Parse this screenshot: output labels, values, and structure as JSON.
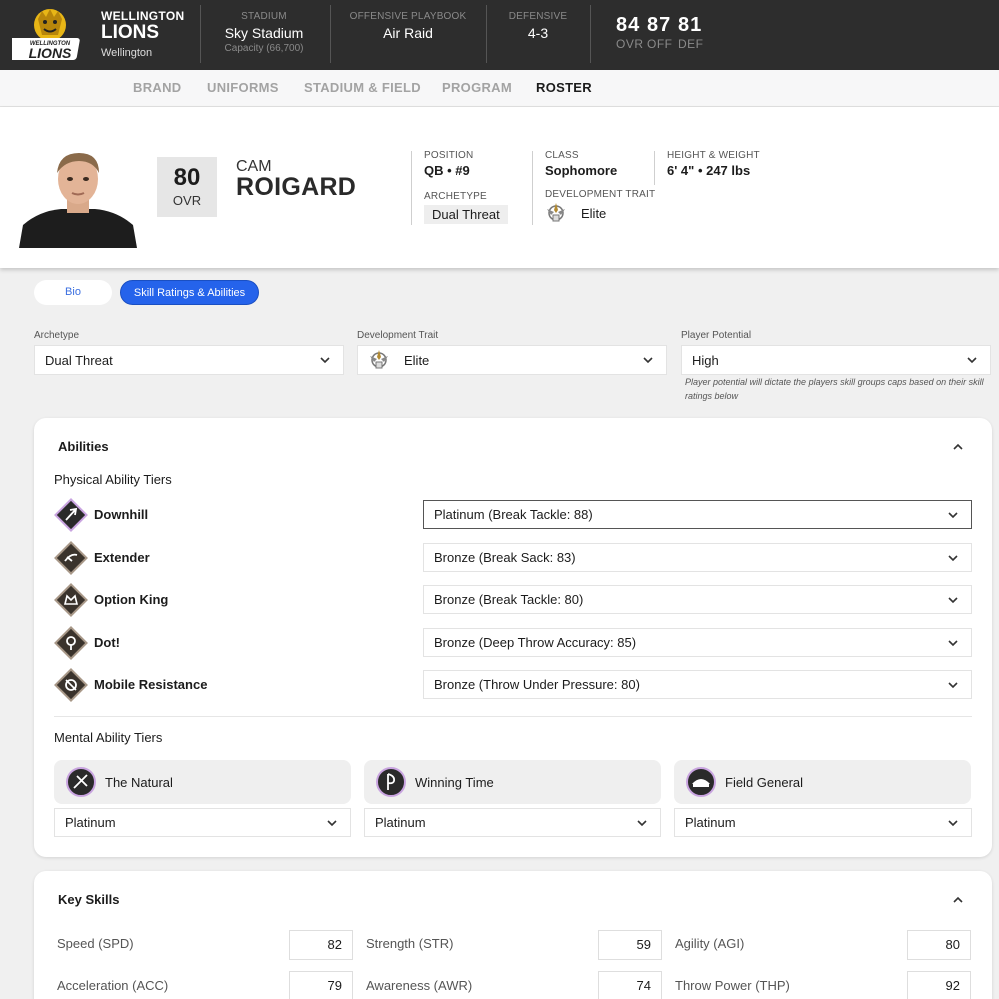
{
  "team": {
    "city": "WELLINGTON",
    "name": "LIONS",
    "location": "Wellington",
    "logo_text": "WELLINGTON LIONS"
  },
  "header": {
    "stadium": {
      "label": "STADIUM",
      "value": "Sky Stadium",
      "sub": "Capacity (66,700)"
    },
    "offense": {
      "label": "OFFENSIVE PLAYBOOK",
      "value": "Air Raid"
    },
    "defense": {
      "label": "DEFENSIVE",
      "value": "4-3"
    },
    "ratings": [
      {
        "value": "84",
        "label": "OVR"
      },
      {
        "value": "87",
        "label": "OFF"
      },
      {
        "value": "81",
        "label": "DEF"
      }
    ]
  },
  "nav": [
    {
      "label": "BRAND",
      "active": false
    },
    {
      "label": "UNIFORMS",
      "active": false
    },
    {
      "label": "STADIUM & FIELD",
      "active": false
    },
    {
      "label": "PROGRAM",
      "active": false
    },
    {
      "label": "ROSTER",
      "active": true
    }
  ],
  "player": {
    "overall": "80",
    "overall_label": "OVR",
    "first_name": "CAM",
    "last_name": "ROIGARD",
    "position_label": "POSITION",
    "position": "QB • #9",
    "class_label": "CLASS",
    "class": "Sophomore",
    "hw_label": "HEIGHT & WEIGHT",
    "hw": "6' 4\" • 247 lbs",
    "archetype_label": "ARCHETYPE",
    "archetype": "Dual Threat",
    "dev_label": "DEVELOPMENT TRAIT",
    "dev": "Elite"
  },
  "tabs": {
    "bio": "Bio",
    "skills": "Skill Ratings & Abilities"
  },
  "fields": {
    "archetype": {
      "label": "Archetype",
      "value": "Dual Threat"
    },
    "dev_trait": {
      "label": "Development Trait",
      "value": "Elite"
    },
    "potential": {
      "label": "Player Potential",
      "value": "High"
    },
    "potential_hint": "Player potential will dictate the players skill groups caps based on their skill ratings below"
  },
  "abilities": {
    "title": "Abilities",
    "physical_label": "Physical Ability Tiers",
    "physical": [
      {
        "name": "Downhill",
        "value": "Platinum (Break Tackle: 88)",
        "icon": "downhill-icon"
      },
      {
        "name": "Extender",
        "value": "Bronze (Break Sack: 83)",
        "icon": "extender-icon"
      },
      {
        "name": "Option King",
        "value": "Bronze (Break Tackle: 80)",
        "icon": "option-king-icon"
      },
      {
        "name": "Dot!",
        "value": "Bronze (Deep Throw Accuracy: 85)",
        "icon": "dot-icon"
      },
      {
        "name": "Mobile Resistance",
        "value": "Bronze (Throw Under Pressure: 80)",
        "icon": "mobile-resistance-icon"
      }
    ],
    "mental_label": "Mental Ability Tiers",
    "mental": [
      {
        "name": "The Natural",
        "value": "Platinum",
        "icon": "the-natural-icon"
      },
      {
        "name": "Winning Time",
        "value": "Platinum",
        "icon": "winning-time-icon"
      },
      {
        "name": "Field General",
        "value": "Platinum",
        "icon": "field-general-icon"
      }
    ]
  },
  "key_skills": {
    "title": "Key Skills",
    "rows": [
      [
        {
          "label": "Speed (SPD)",
          "value": "82"
        },
        {
          "label": "Strength (STR)",
          "value": "59"
        },
        {
          "label": "Agility (AGI)",
          "value": "80"
        }
      ],
      [
        {
          "label": "Acceleration (ACC)",
          "value": "79"
        },
        {
          "label": "Awareness (AWR)",
          "value": "74"
        },
        {
          "label": "Throw Power (THP)",
          "value": "92"
        }
      ]
    ]
  },
  "colors": {
    "accent": "#2563eb",
    "header_bg": "#2d2d2d",
    "platinum_glow": "#c9a4e0"
  }
}
